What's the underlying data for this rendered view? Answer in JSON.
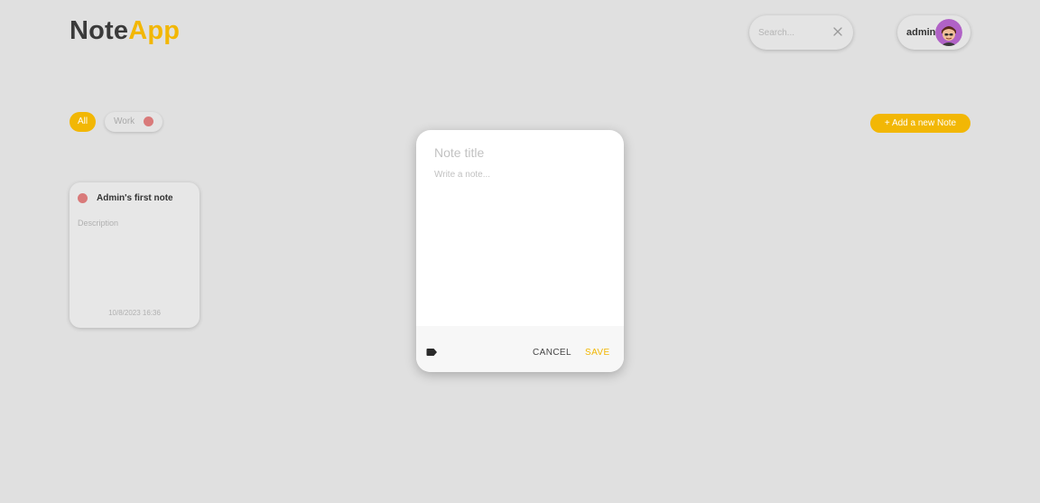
{
  "header": {
    "logo_part1": "Note",
    "logo_part2": "App",
    "search": {
      "placeholder": "Search...",
      "value": "",
      "clear_icon": "close-icon"
    },
    "user": {
      "name": "admin",
      "avatar_icon": "user-avatar"
    }
  },
  "filters": {
    "all_label": "All",
    "work_label": "Work",
    "work_color": "#d97a7a"
  },
  "actions": {
    "add_note_label": "+ Add a new Note"
  },
  "notes": [
    {
      "title": "Admin's first note",
      "description": "Description",
      "date": "10/8/2023 16:36",
      "tag_color": "#d97a7a"
    }
  ],
  "modal": {
    "title_placeholder": "Note title",
    "title_value": "",
    "body_placeholder": "Write a note...",
    "body_value": "",
    "tag_icon": "label-icon",
    "cancel_label": "CANCEL",
    "save_label": "SAVE"
  },
  "colors": {
    "accent": "#f2b705",
    "background": "#e0e0e0",
    "tag_red": "#d97a7a"
  }
}
